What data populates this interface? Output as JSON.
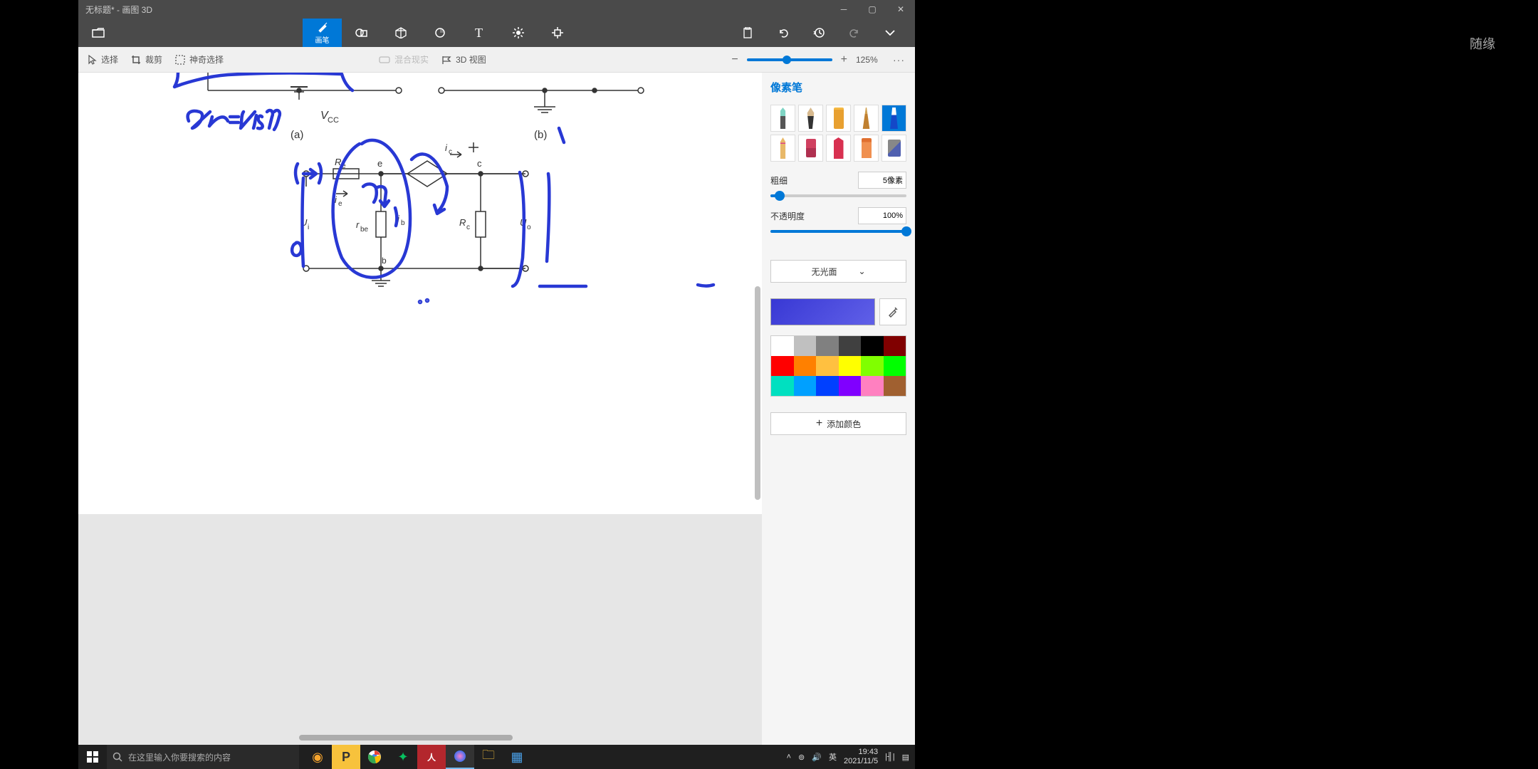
{
  "window": {
    "title": "无标题* - 画图 3D"
  },
  "watermark": "随缘",
  "toolbar": {
    "brush_label": "画笔"
  },
  "subtoolbar": {
    "select": "选择",
    "crop": "裁剪",
    "magic_select": "神奇选择",
    "mixed_reality": "混合现实",
    "view_3d": "3D 视图",
    "zoom": "125%"
  },
  "panel": {
    "title": "像素笔",
    "thickness_label": "粗细",
    "thickness_value": "5像素",
    "opacity_label": "不透明度",
    "opacity_value": "100%",
    "material": "无光面",
    "add_color": "添加颜色"
  },
  "palette": [
    "#ffffff",
    "#c0c0c0",
    "#808080",
    "#404040",
    "#000000",
    "#800000",
    "#ff0000",
    "#ff8000",
    "#ffc040",
    "#ffff00",
    "#80ff00",
    "#00ff00",
    "#00e0c0",
    "#00a0ff",
    "#0040ff",
    "#8000ff",
    "#ff80c0",
    "#a06030"
  ],
  "taskbar": {
    "search_placeholder": "在这里输入你要搜索的内容",
    "ime": "英",
    "time": "19:43",
    "date": "2021/11/5"
  }
}
